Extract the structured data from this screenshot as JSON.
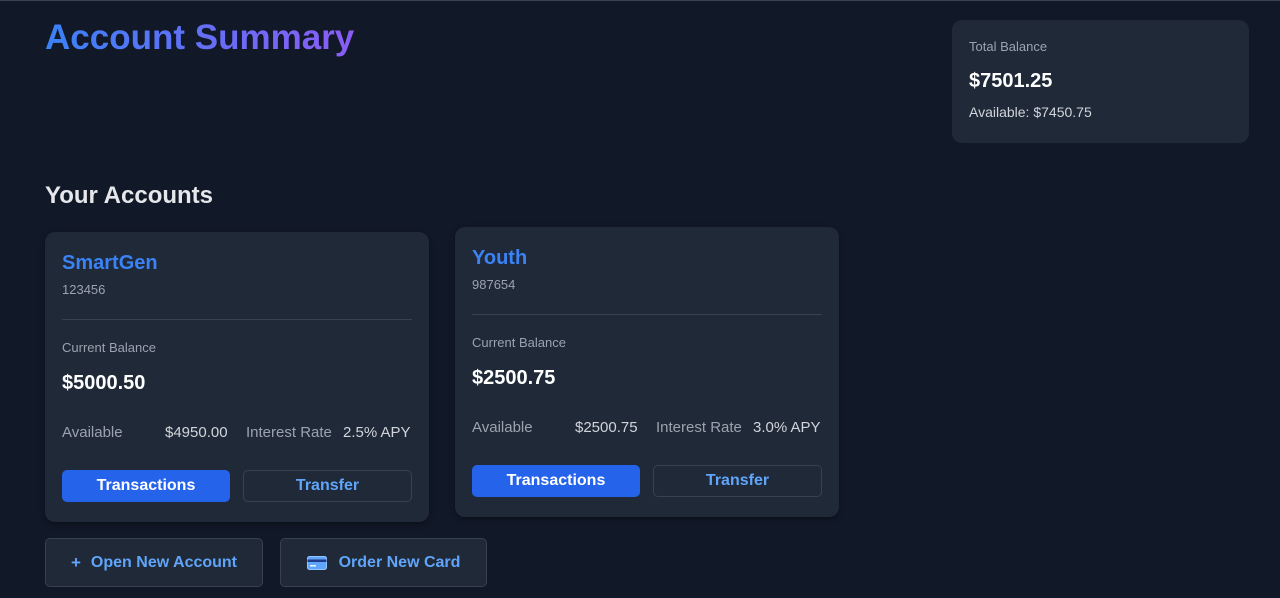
{
  "header": {
    "title": "Account Summary"
  },
  "summary": {
    "total_label": "Total Balance",
    "total_value": "$7501.25",
    "available_text": "Available: $7450.75"
  },
  "accounts_section": {
    "title": "Your Accounts"
  },
  "accounts": [
    {
      "name": "SmartGen",
      "number": "123456",
      "balance_label": "Current Balance",
      "balance": "$5000.50",
      "available_label": "Available",
      "available": "$4950.00",
      "interest_label": "Interest Rate",
      "interest": "2.5% APY",
      "transactions_label": "Transactions",
      "transfer_label": "Transfer"
    },
    {
      "name": "Youth",
      "number": "987654",
      "balance_label": "Current Balance",
      "balance": "$2500.75",
      "available_label": "Available",
      "available": "$2500.75",
      "interest_label": "Interest Rate",
      "interest": "3.0% APY",
      "transactions_label": "Transactions",
      "transfer_label": "Transfer"
    }
  ],
  "actions": {
    "open_account_icon": "+",
    "open_account_label": "Open New Account",
    "order_card_label": "Order New Card"
  },
  "colors": {
    "background": "#111827",
    "card": "#1f2937",
    "accent": "#3b82f6",
    "primary_button": "#2563eb",
    "title_gradient_end": "#8b5cf6"
  }
}
